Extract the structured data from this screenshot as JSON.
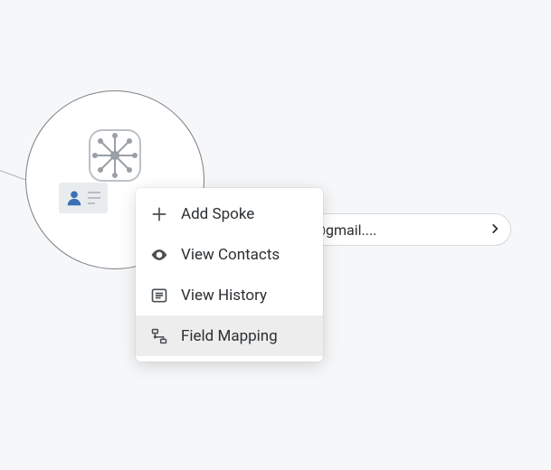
{
  "node": {
    "pill_text": "Spot-fpseggo@gmail...."
  },
  "menu": {
    "items": [
      {
        "label": "Add Spoke"
      },
      {
        "label": "View Contacts"
      },
      {
        "label": "View History"
      },
      {
        "label": "Field Mapping"
      }
    ],
    "hovered_index": 3
  }
}
